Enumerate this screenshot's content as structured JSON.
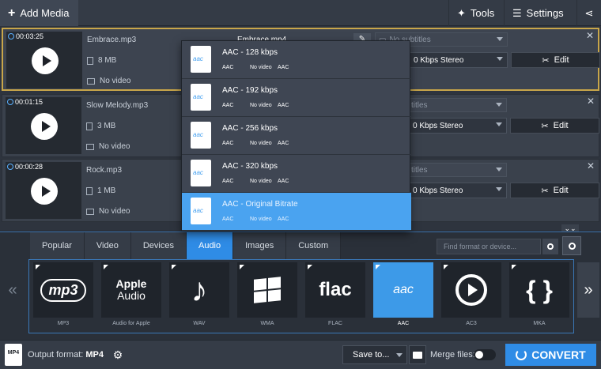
{
  "toolbar": {
    "add_media": "Add Media",
    "tools": "Tools",
    "settings": "Settings"
  },
  "files": [
    {
      "time": "00:03:25",
      "name": "Embrace.mp3",
      "size": "8 MB",
      "video": "No video",
      "output": "Embrace.mp4",
      "subtitles": "No subtitles",
      "audio": "0 Kbps Stereo",
      "edit": "Edit"
    },
    {
      "time": "00:01:15",
      "name": "Slow Melody.mp3",
      "size": "3 MB",
      "video": "No video",
      "subtitles": "titles",
      "audio": "0 Kbps Stereo",
      "edit": "Edit"
    },
    {
      "time": "00:00:28",
      "name": "Rock.mp3",
      "size": "1 MB",
      "video": "No video",
      "subtitles": "titles",
      "audio": "0 Kbps Stereo",
      "edit": "Edit"
    }
  ],
  "popup": {
    "items": [
      {
        "title": "AAC - 128 kbps",
        "meta": [
          "AAC",
          "No video",
          "AAC"
        ]
      },
      {
        "title": "AAC - 192 kbps",
        "meta": [
          "AAC",
          "No video",
          "AAC"
        ]
      },
      {
        "title": "AAC - 256 kbps",
        "meta": [
          "AAC",
          "No video",
          "AAC"
        ]
      },
      {
        "title": "AAC - 320 kbps",
        "meta": [
          "AAC",
          "No video",
          "AAC"
        ]
      },
      {
        "title": "AAC - Original Bitrate",
        "meta": [
          "AAC",
          "No video",
          "AAC"
        ]
      }
    ],
    "icon_text": "aac",
    "selected_index": 4
  },
  "tabs": [
    "Popular",
    "Video",
    "Devices",
    "Audio",
    "Images",
    "Custom"
  ],
  "active_tab": "Audio",
  "search": {
    "placeholder": "Find format or device..."
  },
  "formats": [
    {
      "label": "MP3",
      "logo": "mp3"
    },
    {
      "label": "Audio for Apple",
      "logo_line1": "Apple",
      "logo_line2": "Audio"
    },
    {
      "label": "WAV",
      "logo": "music-note"
    },
    {
      "label": "WMA",
      "logo": "windows"
    },
    {
      "label": "FLAC",
      "logo": "flac"
    },
    {
      "label": "AAC",
      "logo": "aac"
    },
    {
      "label": "AC3",
      "logo": "play-circle"
    },
    {
      "label": "MKA",
      "logo": "{ }"
    }
  ],
  "active_format": "AAC",
  "bottom": {
    "icon_text": "MP4",
    "output_label": "Output format:",
    "output_value": "MP4",
    "save_to": "Save to...",
    "merge_files": "Merge files:",
    "convert": "CONVERT"
  },
  "colors": {
    "accent": "#2f8ce6",
    "selected_border": "#c8a64a",
    "popup_active": "#4aa3f0"
  }
}
